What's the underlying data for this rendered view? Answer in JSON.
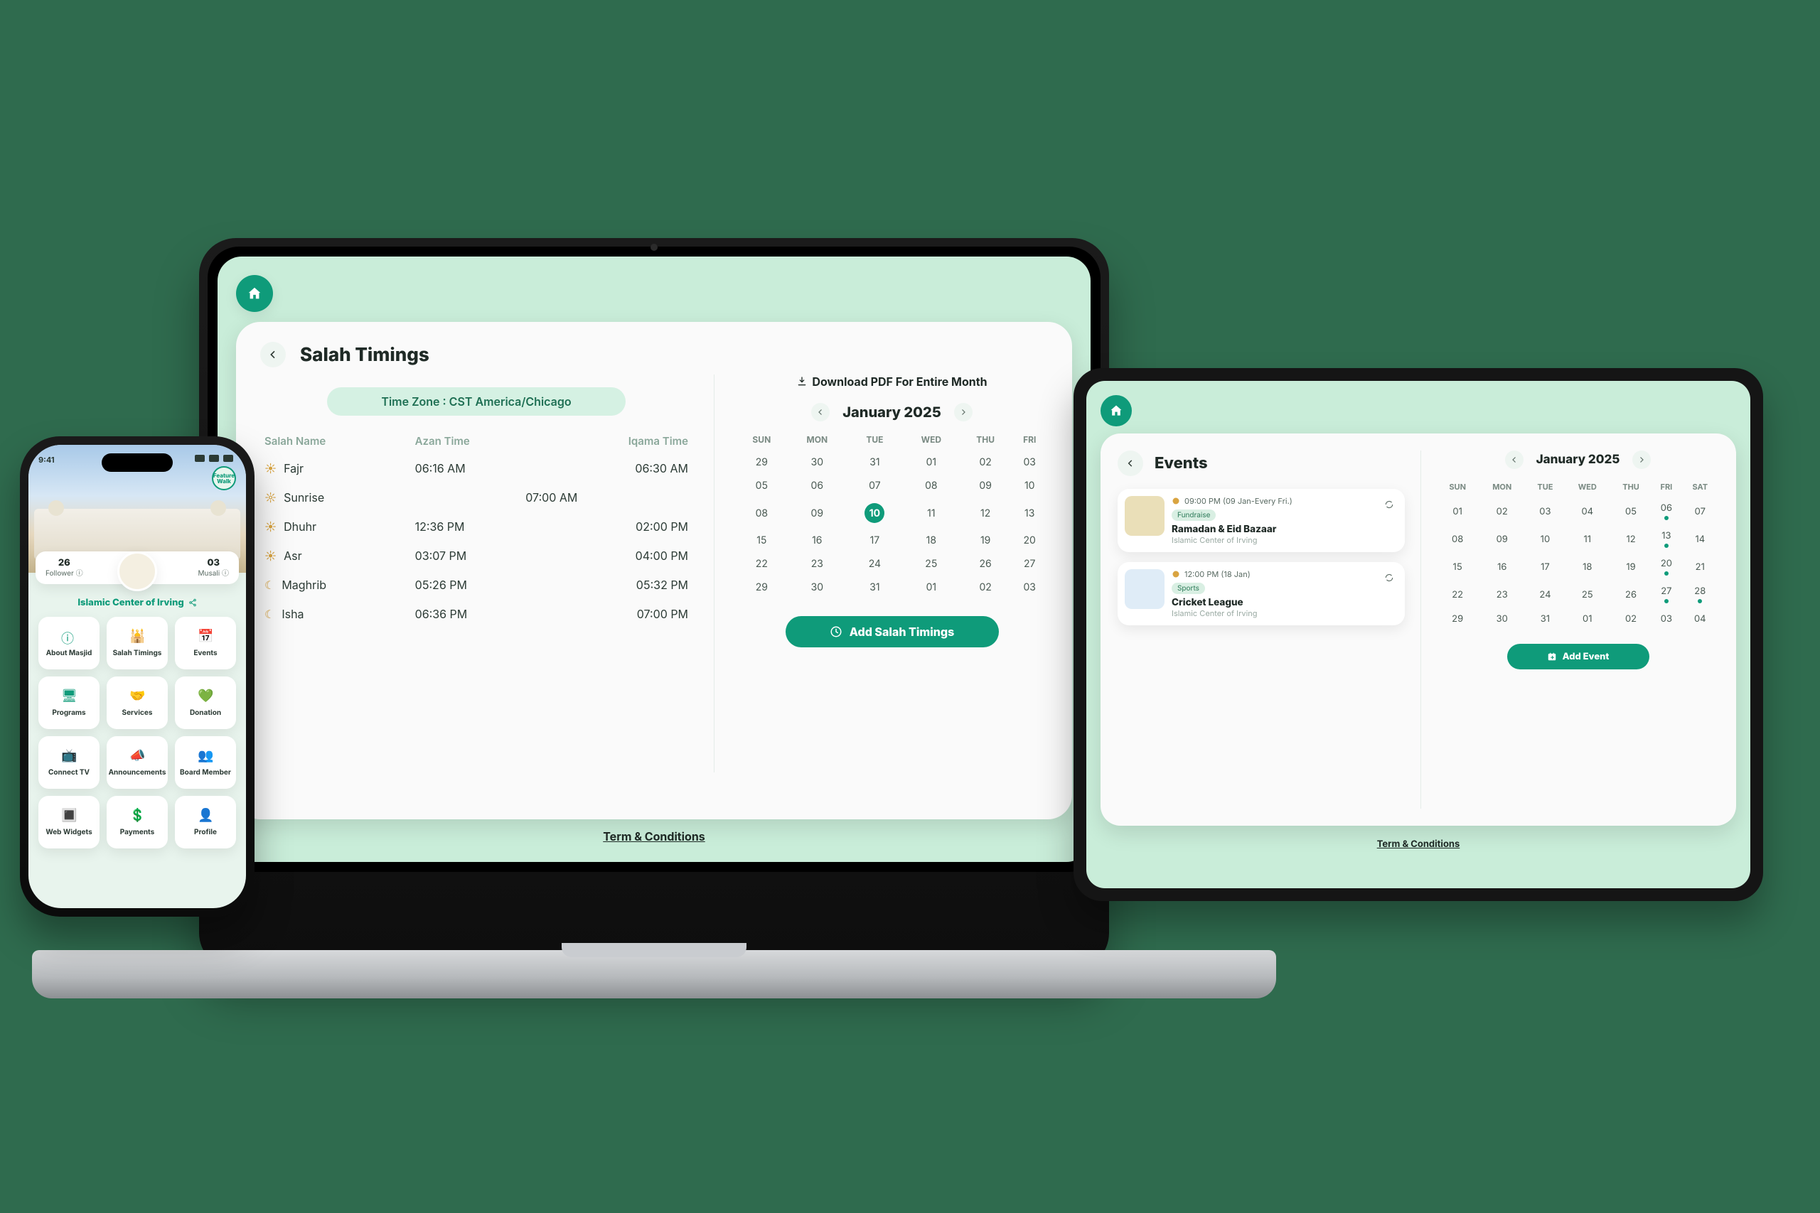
{
  "laptop": {
    "title": "Salah Timings",
    "timezone": "Time Zone : CST America/Chicago",
    "download": "Download PDF For Entire Month",
    "headers": {
      "name": "Salah Name",
      "azan": "Azan Time",
      "iqama": "Iqama Time"
    },
    "rows": [
      {
        "name": "Fajr",
        "azan": "06:16 AM",
        "iqama": "06:30 AM"
      },
      {
        "name": "Sunrise",
        "azan": "07:00 AM",
        "iqama": ""
      },
      {
        "name": "Dhuhr",
        "azan": "12:36 PM",
        "iqama": "02:00 PM"
      },
      {
        "name": "Asr",
        "azan": "03:07 PM",
        "iqama": "04:00 PM"
      },
      {
        "name": "Maghrib",
        "azan": "05:26 PM",
        "iqama": "05:32 PM"
      },
      {
        "name": "Isha",
        "azan": "06:36 PM",
        "iqama": "07:00 PM"
      }
    ],
    "month": "January 2025",
    "dow": [
      "SUN",
      "MON",
      "TUE",
      "WED",
      "THU",
      "FRI"
    ],
    "cal": [
      [
        "29",
        "30",
        "31",
        "01",
        "02",
        "03"
      ],
      [
        "05",
        "06",
        "07",
        "08",
        "09",
        "10"
      ],
      [
        "08",
        "09",
        "10",
        "11",
        "12",
        "13"
      ],
      [
        "15",
        "16",
        "17",
        "18",
        "19",
        "20"
      ],
      [
        "22",
        "23",
        "24",
        "25",
        "26",
        "27"
      ],
      [
        "29",
        "30",
        "31",
        "01",
        "02",
        "03"
      ]
    ],
    "cta": "Add Salah Timings",
    "terms": "Term & Conditions"
  },
  "tablet": {
    "title": "Events",
    "events": [
      {
        "time": "09:00 PM (09 Jan-Every Fri.)",
        "tag": "Fundraise",
        "name": "Ramadan & Eid Bazaar",
        "org": "Islamic Center of Irving"
      },
      {
        "time": "12:00 PM (18 Jan)",
        "tag": "Sports",
        "name": "Cricket League",
        "org": "Islamic Center of Irving"
      }
    ],
    "month": "January 2025",
    "dow": [
      "SUN",
      "MON",
      "TUE",
      "WED",
      "THU",
      "FRI",
      "SAT"
    ],
    "cal": [
      [
        "01",
        "02",
        "03",
        "04",
        "05",
        "06",
        "07"
      ],
      [
        "08",
        "09",
        "10",
        "11",
        "12",
        "13",
        "14"
      ],
      [
        "15",
        "16",
        "17",
        "18",
        "19",
        "20",
        "21"
      ],
      [
        "22",
        "23",
        "24",
        "25",
        "26",
        "27",
        "28"
      ],
      [
        "29",
        "30",
        "31",
        "01",
        "02",
        "03",
        "04"
      ]
    ],
    "dots": [
      "06",
      "13",
      "20",
      "27",
      "28"
    ],
    "cta": "Add Event",
    "terms": "Term & Conditions"
  },
  "phone": {
    "time": "9:41",
    "fab": "Feature Walk",
    "followers": {
      "n": "26",
      "l": "Follower"
    },
    "musali": {
      "n": "03",
      "l": "Musali"
    },
    "center": "Islamic Center of Irving",
    "tiles": [
      "About Masjid",
      "Salah Timings",
      "Events",
      "Programs",
      "Services",
      "Donation",
      "Connect TV",
      "Announcements",
      "Board Member",
      "Web Widgets",
      "Payments",
      "Profile"
    ]
  }
}
